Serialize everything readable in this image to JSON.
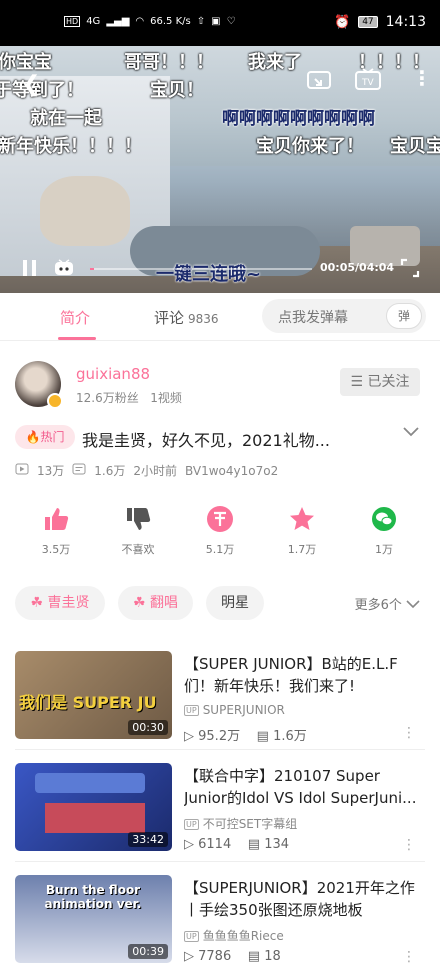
{
  "status_bar": {
    "network": "HD",
    "signal_type": "4G",
    "speed": "66.5 K/s",
    "battery": "47",
    "time": "14:13"
  },
  "player": {
    "danmaku": [
      {
        "text": "你宝宝",
        "style": "white"
      },
      {
        "text": "哥哥！！！",
        "style": "white"
      },
      {
        "text": "我来了",
        "style": "white"
      },
      {
        "text": "！！！！",
        "style": "white"
      },
      {
        "text": "于等到了！",
        "style": "white"
      },
      {
        "text": "宝贝！",
        "style": "white"
      },
      {
        "text": "就在一起",
        "style": "white"
      },
      {
        "text": "啊啊啊啊啊啊啊啊啊",
        "style": "blue"
      },
      {
        "text": "新年快乐！！！！",
        "style": "white"
      },
      {
        "text": "宝贝你来了！",
        "style": "white"
      },
      {
        "text": "宝贝宝",
        "style": "white"
      },
      {
        "text": "一键三连哦~",
        "style": "blue"
      }
    ],
    "time_current": "00:05",
    "time_total": "04:04",
    "progress": 0.02
  },
  "tabs": {
    "intro": "简介",
    "comments": "评论",
    "comment_count": "9836",
    "danmu_placeholder": "点我发弹幕",
    "danmu_icon": "弹"
  },
  "uploader": {
    "name": "guixian88",
    "fans": "12.6万粉丝",
    "videos": "1视频",
    "follow_label": "已关注"
  },
  "video": {
    "hot_label": "热门",
    "title": "我是圭贤，好久不见，2021礼物...",
    "plays": "13万",
    "danmu": "1.6万",
    "time_ago": "2小时前",
    "bvid": "BV1wo4y1o7o2"
  },
  "actions": [
    {
      "icon": "like-icon",
      "label": "3.5万"
    },
    {
      "icon": "dislike-icon",
      "label": "不喜欢"
    },
    {
      "icon": "coin-icon",
      "label": "5.1万"
    },
    {
      "icon": "star-icon",
      "label": "1.7万"
    },
    {
      "icon": "wechat-icon",
      "label": "1万"
    }
  ],
  "tags": {
    "tag1": "曺圭贤",
    "tag2": "翻唱",
    "tag3": "明星",
    "more": "更多6个"
  },
  "recommendations": [
    {
      "title": "【SUPER JUNIOR】B站的E.L.F们！新年快乐！我们来了!",
      "uploader": "SUPERJUNIOR",
      "plays": "95.2万",
      "danmu": "1.6万",
      "duration": "00:30",
      "thumb_text": "我们是 SUPER JU",
      "thumb_color": "#7a5a3c"
    },
    {
      "title": "【联合中字】210107 Super Junior的Idol VS Idol SuperJuni...",
      "uploader": "不可控SET字幕组",
      "plays": "6114",
      "danmu": "134",
      "duration": "33:42",
      "thumb_text": "",
      "thumb_color": "#2b3f8f"
    },
    {
      "title": "【SUPERJUNIOR】2021开年之作丨手绘350张图还原烧地板",
      "uploader": "鱼鱼鱼鱼Riece",
      "plays": "7786",
      "danmu": "18",
      "duration": "00:39",
      "thumb_text": "Burn the floor animation ver.",
      "thumb_color": "#5a6e9c"
    }
  ],
  "colors": {
    "accent": "#fb7299",
    "follow_bg": "#ededed"
  }
}
